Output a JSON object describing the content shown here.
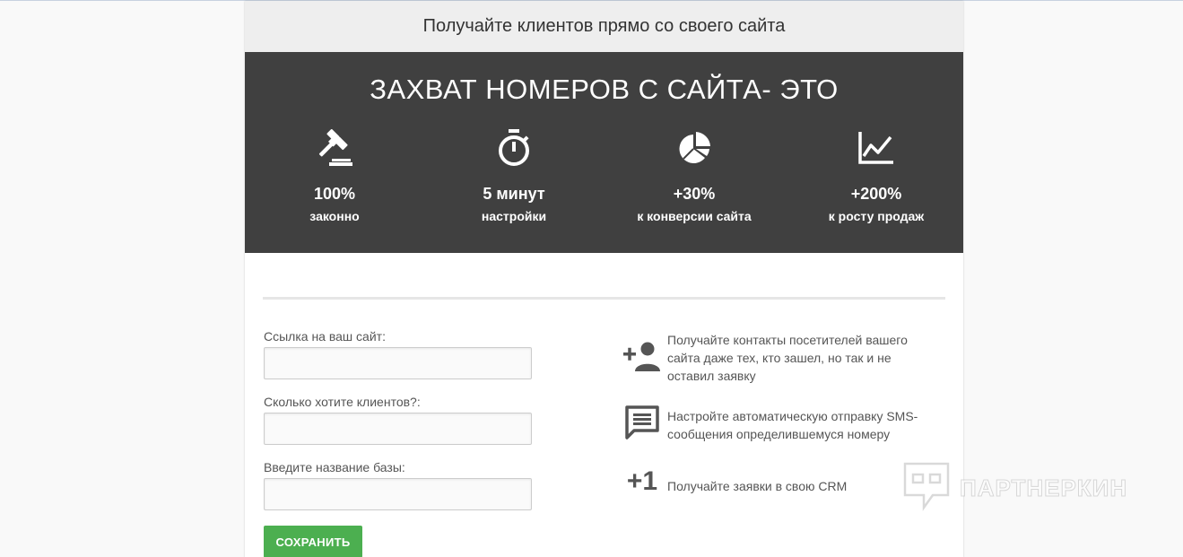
{
  "header": {
    "title": "Получайте клиентов прямо со своего сайта"
  },
  "hero": {
    "title": "ЗАХВАТ НОМЕРОВ С САЙТА- ЭТО",
    "stats": [
      {
        "icon": "gavel-icon",
        "value": "100%",
        "label": "законно"
      },
      {
        "icon": "stopwatch-icon",
        "value": "5 минут",
        "label": "настройки"
      },
      {
        "icon": "pie-chart-icon",
        "value": "+30%",
        "label": "к конверсии сайта"
      },
      {
        "icon": "line-chart-icon",
        "value": "+200%",
        "label": "к росту продаж"
      }
    ]
  },
  "form": {
    "site_label": "Ссылка на ваш сайт:",
    "site_value": "",
    "clients_label": "Сколько хотите клиентов?:",
    "clients_value": "",
    "base_label": "Введите название базы:",
    "base_value": "",
    "save_label": "СОХРАНИТЬ"
  },
  "features": [
    {
      "icon": "add-person-icon",
      "text": "Получайте контакты посетителей вашего сайта даже тех, кто зашел, но так и не оставил заявку"
    },
    {
      "icon": "message-icon",
      "text": "Настройте автоматическую отправку SMS-сообщения определившемуся номеру"
    },
    {
      "icon": "plus-one-icon",
      "symbol": "+1",
      "text": "Получайте заявки в свою CRM"
    }
  ],
  "watermark": {
    "text": "ПАРТНЕРКИН"
  },
  "colors": {
    "dark_bg": "#404040",
    "header_bg": "#eeeeee",
    "save_button": "#4caf50"
  }
}
